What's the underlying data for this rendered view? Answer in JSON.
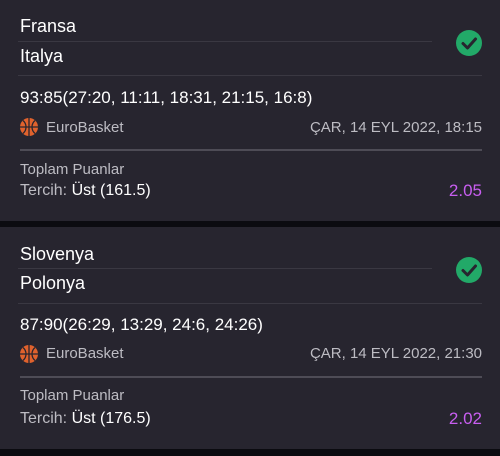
{
  "colors": {
    "card_bg": "#27252f",
    "page_bg": "#0b0b10",
    "won_badge": "#22a968",
    "odds": "#c85ef0",
    "basketball_icon": "#e0622d"
  },
  "bets": [
    {
      "home_team": "Fransa",
      "away_team": "Italya",
      "status_icon": "check-circle-icon",
      "score": "93:85(27:20, 11:11, 18:31, 21:15, 16:8)",
      "league_icon": "basketball-icon",
      "league": "EuroBasket",
      "date": "ÇAR, 14 EYL 2022, 18:15",
      "market": "Toplam Puanlar",
      "pick_label": "Tercih:",
      "pick_value": " Üst (161.5)",
      "odds": "2.05"
    },
    {
      "home_team": "Slovenya",
      "away_team": "Polonya",
      "status_icon": "check-circle-icon",
      "score": "87:90(26:29, 13:29, 24:6, 24:26)",
      "league_icon": "basketball-icon",
      "league": "EuroBasket",
      "date": "ÇAR, 14 EYL 2022, 21:30",
      "market": "Toplam Puanlar",
      "pick_label": "Tercih:",
      "pick_value": " Üst (176.5)",
      "odds": "2.02"
    }
  ]
}
